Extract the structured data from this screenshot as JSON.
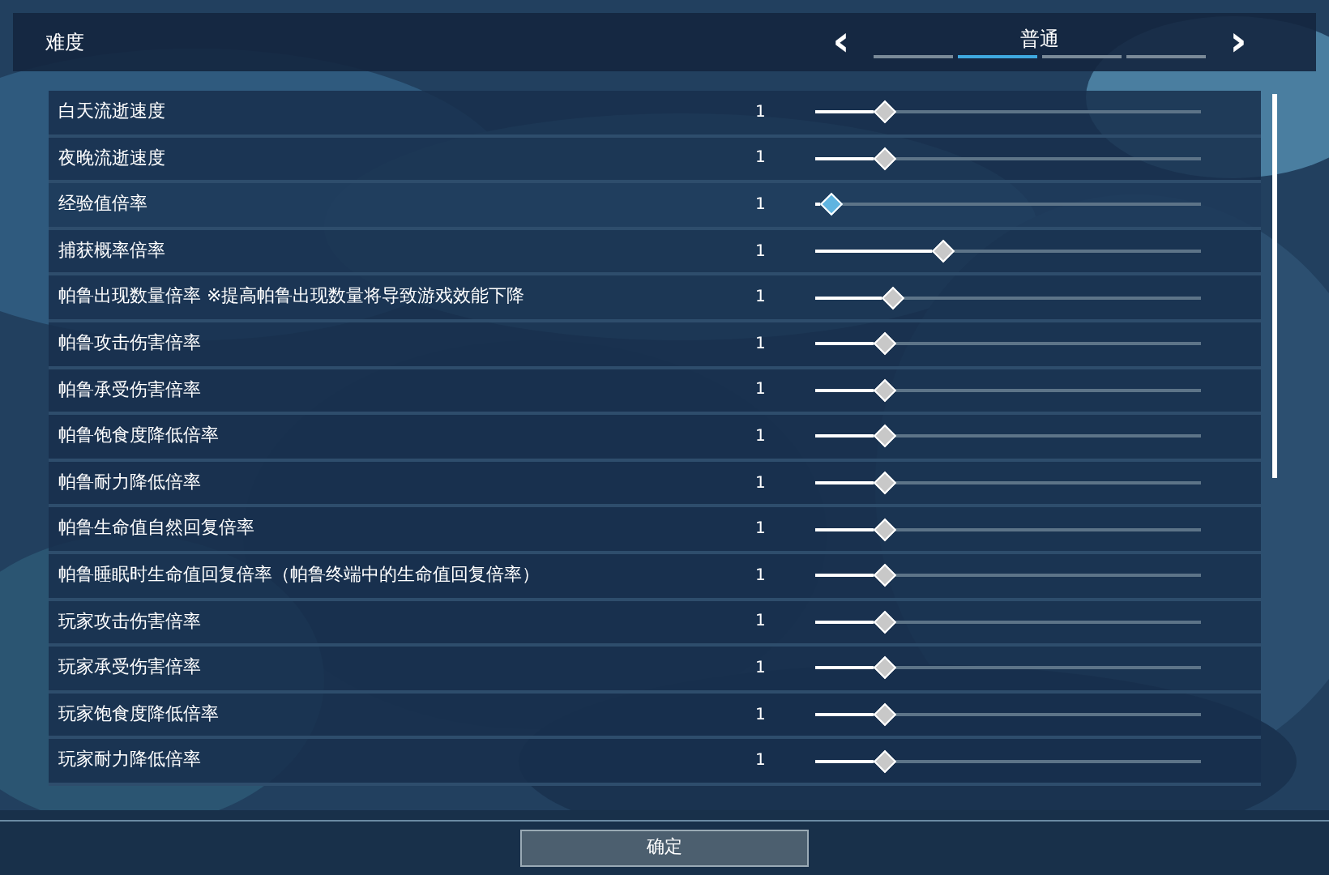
{
  "header": {
    "label": "难度",
    "prev": "‹",
    "value": "普通",
    "next": "›",
    "steps": [
      {
        "selected": false
      },
      {
        "selected": true
      },
      {
        "selected": false
      },
      {
        "selected": false
      }
    ]
  },
  "settings": [
    {
      "label": "白天流逝速度",
      "value": "1",
      "level": 0.18,
      "selected": false
    },
    {
      "label": "夜晚流逝速度",
      "value": "1",
      "level": 0.18,
      "selected": false
    },
    {
      "label": "经验值倍率",
      "value": "1",
      "level": 0.04,
      "selected": true
    },
    {
      "label": "捕获概率倍率",
      "value": "1",
      "level": 0.33,
      "selected": false
    },
    {
      "label": "帕鲁出现数量倍率 ※提高帕鲁出现数量将导致游戏效能下降",
      "value": "1",
      "level": 0.2,
      "selected": false
    },
    {
      "label": "帕鲁攻击伤害倍率",
      "value": "1",
      "level": 0.18,
      "selected": false
    },
    {
      "label": "帕鲁承受伤害倍率",
      "value": "1",
      "level": 0.18,
      "selected": false
    },
    {
      "label": "帕鲁饱食度降低倍率",
      "value": "1",
      "level": 0.18,
      "selected": false
    },
    {
      "label": "帕鲁耐力降低倍率",
      "value": "1",
      "level": 0.18,
      "selected": false
    },
    {
      "label": "帕鲁生命值自然回复倍率",
      "value": "1",
      "level": 0.18,
      "selected": false
    },
    {
      "label": "帕鲁睡眠时生命值回复倍率（帕鲁终端中的生命值回复倍率）",
      "value": "1",
      "level": 0.18,
      "selected": false
    },
    {
      "label": "玩家攻击伤害倍率",
      "value": "1",
      "level": 0.18,
      "selected": false
    },
    {
      "label": "玩家承受伤害倍率",
      "value": "1",
      "level": 0.18,
      "selected": false
    },
    {
      "label": "玩家饱食度降低倍率",
      "value": "1",
      "level": 0.18,
      "selected": false
    },
    {
      "label": "玩家耐力降低倍率",
      "value": "1",
      "level": 0.18,
      "selected": false
    }
  ],
  "confirm": "确定"
}
